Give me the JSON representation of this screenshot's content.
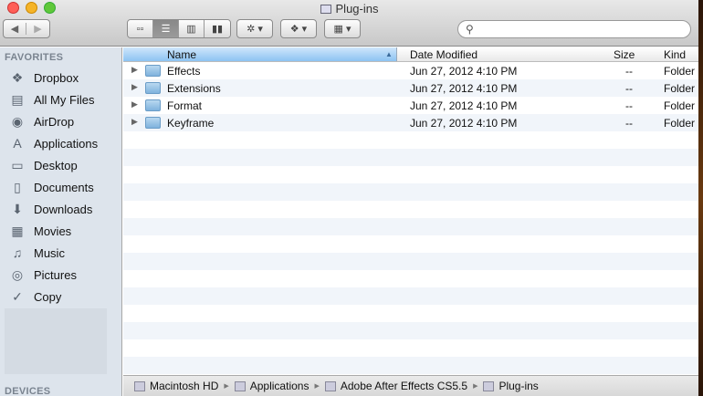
{
  "window": {
    "title": "Plug-ins",
    "colors": {
      "close": "#ff5f57",
      "minimize": "#f5b428",
      "zoom": "#5fc83a"
    }
  },
  "toolbar": {
    "back_icon": "◀",
    "forward_icon": "▶",
    "views": [
      "icon-view",
      "list-view",
      "column-view",
      "coverflow-view"
    ],
    "view_glyphs": [
      "▫▫",
      "☰",
      "▥",
      "▮▮"
    ],
    "action_glyph": "✲ ▾",
    "dropbox_glyph": "❖ ▾",
    "arrange_glyph": "▦ ▾",
    "search_placeholder": ""
  },
  "sidebar": {
    "favorites_header": "FAVORITES",
    "items": [
      {
        "label": "Dropbox",
        "icon": "❖"
      },
      {
        "label": "All My Files",
        "icon": "▤"
      },
      {
        "label": "AirDrop",
        "icon": "◉"
      },
      {
        "label": "Applications",
        "icon": "A"
      },
      {
        "label": "Desktop",
        "icon": "▭"
      },
      {
        "label": "Documents",
        "icon": "▯"
      },
      {
        "label": "Downloads",
        "icon": "⬇"
      },
      {
        "label": "Movies",
        "icon": "▦"
      },
      {
        "label": "Music",
        "icon": "♫"
      },
      {
        "label": "Pictures",
        "icon": "◎"
      },
      {
        "label": "Copy",
        "icon": "✓"
      }
    ],
    "devices_header": "DEVICES"
  },
  "columns": {
    "name": "Name",
    "date": "Date Modified",
    "size": "Size",
    "kind": "Kind",
    "sort_icon": "▲"
  },
  "files": [
    {
      "name": "Effects",
      "date": "Jun 27, 2012 4:10 PM",
      "size": "--",
      "kind": "Folder"
    },
    {
      "name": "Extensions",
      "date": "Jun 27, 2012 4:10 PM",
      "size": "--",
      "kind": "Folder"
    },
    {
      "name": "Format",
      "date": "Jun 27, 2012 4:10 PM",
      "size": "--",
      "kind": "Folder"
    },
    {
      "name": "Keyframe",
      "date": "Jun 27, 2012 4:10 PM",
      "size": "--",
      "kind": "Folder"
    }
  ],
  "path": [
    "Macintosh HD",
    "Applications",
    "Adobe After Effects CS5.5",
    "Plug-ins"
  ]
}
